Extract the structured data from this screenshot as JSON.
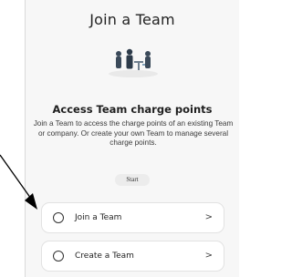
{
  "title": "Join a Team",
  "heading": "Access Team charge points",
  "description": "Join a Team to access the charge points of an existing Team or company. Or create your own Team to manage several charge points.",
  "start_label": "Start",
  "options": [
    {
      "label": "Join a Team",
      "chevron": ">"
    },
    {
      "label": "Create a Team",
      "chevron": ">"
    }
  ],
  "colors": {
    "panel_bg": "#f7f7f7",
    "card_bg": "#ffffff",
    "text": "#1f1f1f"
  },
  "icons": {
    "illustration": "team-illustration-icon",
    "radio": "radio-icon",
    "chevron": "chevron-right-icon",
    "pointer": "arrow-pointer-icon"
  }
}
